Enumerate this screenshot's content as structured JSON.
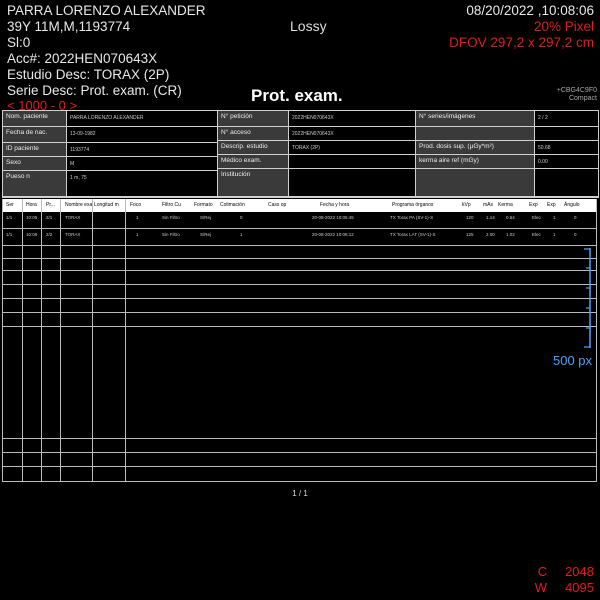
{
  "overlay": {
    "patient_name": "PARRA LORENZO ALEXANDER",
    "patient_line2": "39Y 11M,M,1193774",
    "slice": "Sl:0",
    "accession": "Acc#: 2022HEN070643X",
    "study_desc": "Estudio Desc: TORAX (2P)",
    "series_desc": "Serie Desc: Prot. exam. (CR)",
    "datetime": "08/20/2022 ,10:08:06",
    "pixel": "20% Pixel",
    "dfov": "DFOV 297,2 x 297,2 cm",
    "lossy": "Lossy",
    "window_range": "< 1000 - 0 >",
    "scale": "500 px",
    "center_label": "C",
    "center_value": "2048",
    "width_label": "W",
    "width_value": "4095"
  },
  "report": {
    "title": "Prot. exam.",
    "logo_line1": "+CBG4C9F0",
    "logo_line2": "Compact"
  },
  "info": {
    "labels": {
      "nombre": "Nom. paciente",
      "fecha_nac": "Fecha de nac.",
      "id": "ID paciente",
      "sexo": "Sexo",
      "peso": "Pueso n",
      "peticion": "N° petición",
      "acceso": "N° acceso",
      "descrip": "Descrip. estudio",
      "medico": "Médico exam.",
      "institucion": "Institución",
      "series": "N° series/imágenes",
      "prod_dosis": "Prod. dosis sup. (µGy*m²)",
      "kerma": "kerma aire ref (mGy)"
    },
    "values": {
      "nombre": "PARRA LORENZO ALEXANDER",
      "fecha_nac": "13-09-1982",
      "id": "1193774",
      "sexo": "M",
      "peso": "1 m, 75",
      "peticion": "2022HEN070643X",
      "acceso": "2022HEN070643X",
      "descrip": "TORAX (2P)",
      "series": "2 / 2",
      "prod_dosis": "50.68",
      "kerma": "0.00"
    }
  },
  "series_table": {
    "headers": [
      "Ser",
      "Hora",
      "Pr...",
      "Nombre exa",
      "Longitud m",
      "Foco",
      "Filtro Cu",
      "Formato",
      "Colimación",
      "Cass op",
      "Fecha y hora",
      "Programa órganos",
      "kVp",
      "mAs",
      "Kerma",
      "Exp",
      "Exp",
      "Ángulo"
    ],
    "rows": [
      [
        "1/1",
        "10:05",
        "2/1",
        "TORAX",
        "",
        "1",
        "Sin Filtro",
        "S/Rej",
        "0",
        "",
        "20-08-2022 10:05:45",
        "TX Torax PA (SV-1)-S",
        "120",
        "1.14",
        "0.54",
        "Elec",
        "1",
        "0"
      ],
      [
        "1/1",
        "10:06",
        "2/2",
        "TORAX",
        "",
        "1",
        "Sin Filtro",
        "S/Rej",
        "1",
        "",
        "20-08-2022 10:06:12",
        "TX Torax LAT (SV-1)-S",
        "125",
        "2.00",
        "1.02",
        "Elec",
        "1",
        "0"
      ]
    ]
  },
  "page_indicator": "1 / 1"
}
